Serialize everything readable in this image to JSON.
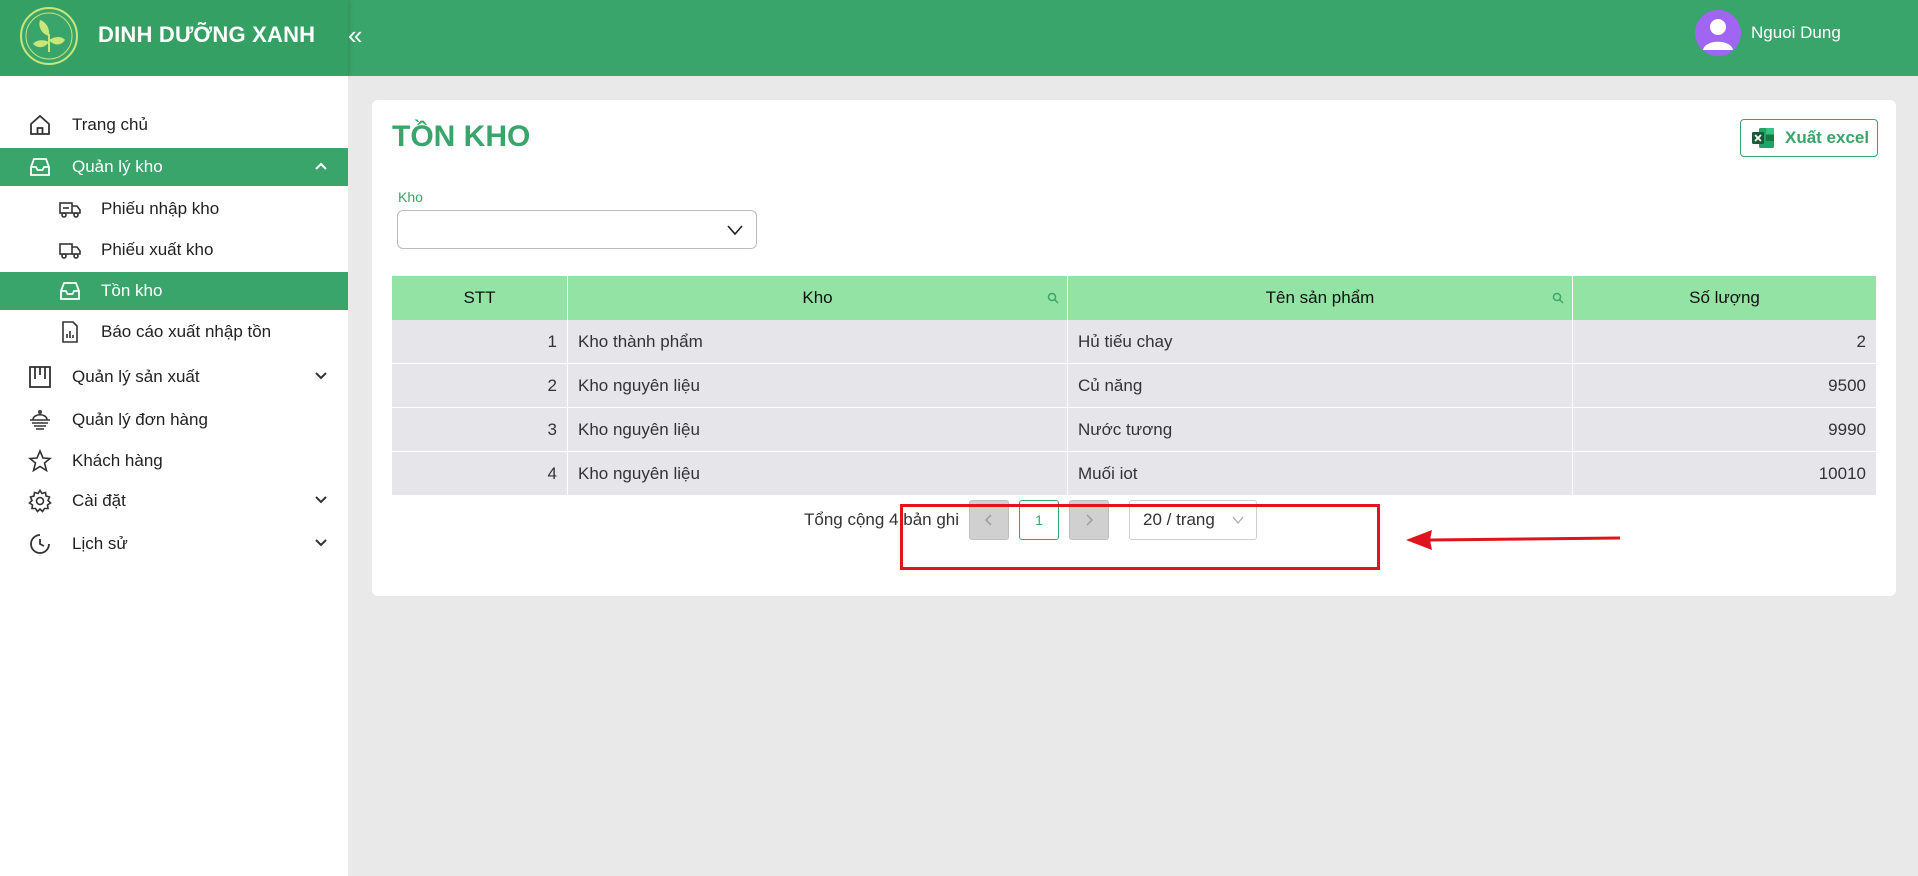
{
  "header": {
    "brand": "DINH DƯỠNG XANH",
    "collapse_icon": "«",
    "user_name": "Nguoi Dung"
  },
  "sidebar": {
    "items": [
      {
        "label": "Trang chủ",
        "icon": "home-icon"
      },
      {
        "label": "Quản lý kho",
        "icon": "inbox-icon",
        "active": true,
        "expanded": true
      },
      {
        "label": "Phiếu nhập kho",
        "icon": "truck-in-icon"
      },
      {
        "label": "Phiếu xuất kho",
        "icon": "truck-out-icon"
      },
      {
        "label": "Tồn kho",
        "icon": "inbox-icon",
        "active": true
      },
      {
        "label": "Báo cáo xuất nhập tồn",
        "icon": "report-icon"
      },
      {
        "label": "Quản lý sản xuất",
        "icon": "factory-icon"
      },
      {
        "label": "Quản lý đơn hàng",
        "icon": "order-icon"
      },
      {
        "label": "Khách hàng",
        "icon": "star-icon"
      },
      {
        "label": "Cài đặt",
        "icon": "gear-icon"
      },
      {
        "label": "Lịch sử",
        "icon": "history-icon"
      }
    ]
  },
  "main": {
    "title": "TỒN KHO",
    "export_label": "Xuất excel",
    "filter": {
      "label": "Kho",
      "value": ""
    },
    "table": {
      "columns": [
        "STT",
        "Kho",
        "Tên sản phẩm",
        "Số lượng"
      ],
      "rows": [
        [
          "1",
          "Kho thành phẩm",
          "Hủ tiếu chay",
          "2"
        ],
        [
          "2",
          "Kho nguyên liệu",
          "Củ năng",
          "9500"
        ],
        [
          "3",
          "Kho nguyên liệu",
          "Nước tương",
          "9990"
        ],
        [
          "4",
          "Kho nguyên liệu",
          "Muối iot",
          "10010"
        ]
      ]
    },
    "pagination": {
      "total_text": "Tổng cộng 4 bản ghi",
      "current_page": "1",
      "page_size": "20 / trang"
    }
  },
  "colors": {
    "brand_green": "#3aa56a",
    "header_green": "#93e3a5",
    "annotation_red": "#e0141e",
    "avatar_purple": "#a065f2"
  }
}
